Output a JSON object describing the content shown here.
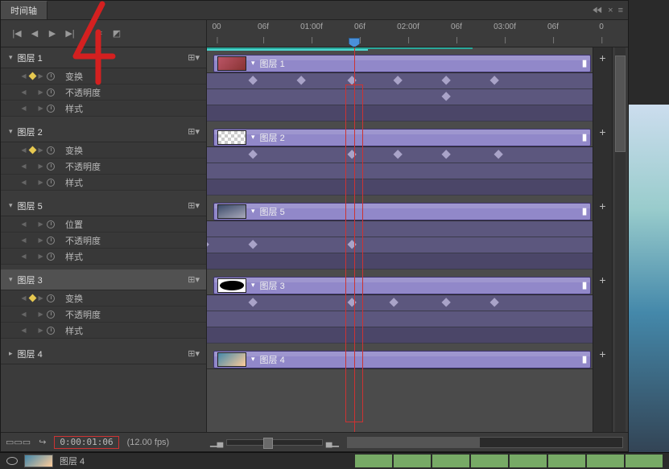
{
  "panel": {
    "title": "时间轴"
  },
  "transport": {
    "go_start": "|◀",
    "prev": "◀",
    "play": "▶",
    "go_end": "▶|",
    "split": "✂",
    "convert": "◩"
  },
  "ruler": {
    "ticks": [
      "00",
      "06f",
      "01:00f",
      "06f",
      "02:00f",
      "06f",
      "03:00f",
      "06f",
      "0"
    ]
  },
  "playhead_label": "",
  "layers": [
    {
      "name": "图层 1",
      "clip": "图层 1",
      "selected": false,
      "props": [
        {
          "n": "变换",
          "k": true
        },
        {
          "n": "不透明度",
          "k": false
        },
        {
          "n": "样式",
          "k": false
        }
      ],
      "kf_rows": [
        {
          "pos": [
            60,
            120,
            183,
            240,
            300,
            360
          ],
          "alt": false
        },
        {
          "pos": [
            300
          ],
          "alt": false
        },
        {
          "pos": [],
          "alt": true
        }
      ],
      "thumb": "hand"
    },
    {
      "name": "图层 2",
      "clip": "图层 2",
      "selected": false,
      "props": [
        {
          "n": "变换",
          "k": true
        },
        {
          "n": "不透明度",
          "k": false
        },
        {
          "n": "样式",
          "k": false
        }
      ],
      "kf_rows": [
        {
          "pos": [
            60,
            183,
            240,
            300,
            365
          ],
          "alt": false
        },
        {
          "pos": [],
          "alt": false
        },
        {
          "pos": [],
          "alt": true
        }
      ],
      "thumb": "checker"
    },
    {
      "name": "图层 5",
      "clip": "图层 5",
      "selected": false,
      "props": [
        {
          "n": "位置",
          "k": false
        },
        {
          "n": "不透明度",
          "k": false
        },
        {
          "n": "样式",
          "k": false
        }
      ],
      "kf_rows": [
        {
          "pos": [],
          "alt": false
        },
        {
          "pos": [
            0,
            60,
            183
          ],
          "alt": false
        },
        {
          "pos": [],
          "alt": true
        }
      ],
      "thumb": "city"
    },
    {
      "name": "图层 3",
      "clip": "图层 3",
      "selected": true,
      "props": [
        {
          "n": "变换",
          "k": true
        },
        {
          "n": "不透明度",
          "k": false
        },
        {
          "n": "样式",
          "k": false
        }
      ],
      "kf_rows": [
        {
          "pos": [
            60,
            183,
            235,
            300,
            360
          ],
          "alt": false
        },
        {
          "pos": [],
          "alt": false
        },
        {
          "pos": [],
          "alt": true
        }
      ],
      "thumb": "blob"
    },
    {
      "name": "图层 4",
      "clip": "图层 4",
      "selected": false,
      "props": [],
      "kf_rows": [],
      "thumb": "sky"
    }
  ],
  "footer": {
    "timecode": "0:00:01:06",
    "fps": "(12.00 fps)"
  },
  "substrip": {
    "label": "图层 4"
  },
  "annotation": "4",
  "icons": {
    "menu": "≡",
    "close": "×",
    "chev": "▸",
    "chev_d": "▾",
    "plus": "+"
  }
}
